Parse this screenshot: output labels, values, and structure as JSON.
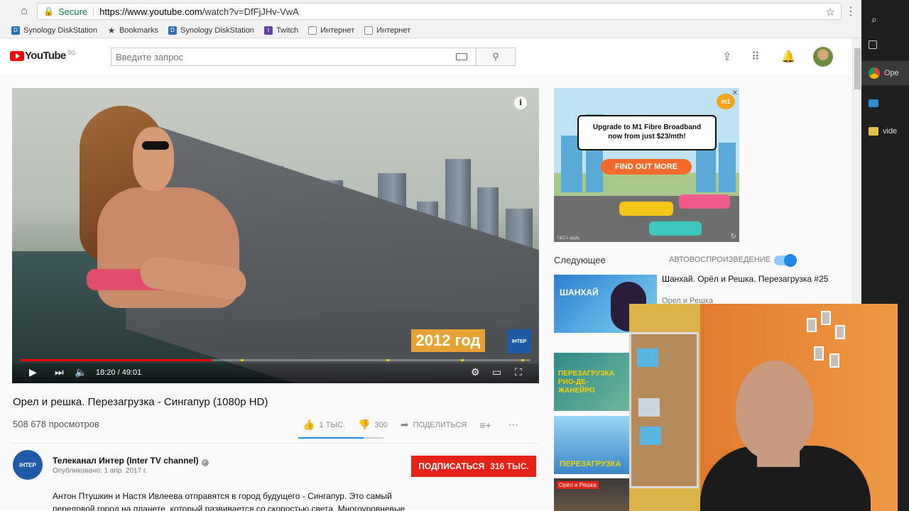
{
  "browser": {
    "secure_label": "Secure",
    "url_host": "https://www.youtube.com",
    "url_path": "/watch?v=DfFjJHv-VwA",
    "bookmarks": [
      {
        "label": "Synology DiskStation",
        "icon": "dsm"
      },
      {
        "label": "Bookmarks",
        "icon": "star"
      },
      {
        "label": "Synology DiskStation",
        "icon": "dsm"
      },
      {
        "label": "Twitch",
        "icon": "twitch"
      },
      {
        "label": "Интернет",
        "icon": "doc"
      },
      {
        "label": "Интернет",
        "icon": "doc"
      }
    ]
  },
  "desktop_strip": {
    "items": [
      {
        "label": "",
        "icon": "search-icon"
      },
      {
        "label": "",
        "icon": "task-view-icon"
      },
      {
        "label": "Ope",
        "icon": "chrome-icon"
      },
      {
        "label": "",
        "icon": "computer-icon"
      },
      {
        "label": "vide",
        "icon": "folder-icon"
      }
    ]
  },
  "youtube": {
    "logo_text": "YouTube",
    "region": "SG",
    "search_placeholder": "Введите запрос"
  },
  "player": {
    "time": "18:20 / 49:01",
    "progress_fraction": 0.374,
    "year_badge": "2012 год",
    "channel_watermark": "ІНТЕР"
  },
  "video": {
    "title": "Орел и решка. Перезагрузка - Сингапур (1080p HD)",
    "views": "508 678 просмотров",
    "likes": "1 ТЫС.",
    "dislikes": "300",
    "share": "ПОДЕЛИТЬСЯ",
    "like_ratio": 0.77
  },
  "channel": {
    "avatar_text": "ІНТЕР",
    "name": "Телеканал Интер (Inter TV channel)",
    "published": "Опубликовано: 1 апр. 2017 г.",
    "subscribe": "ПОДПИСАТЬСЯ",
    "subscribers": "316 ТЫС.",
    "description": "Антон Птушкин и Настя Ивлеева отправятся в город будущего - Сингапур. Это самый передовой город на планете, который развивается со скоростью света. Многоуровневые"
  },
  "ad": {
    "headline_line1": "Upgrade to M1 Fibre Broadband",
    "headline_line2": "now from just $23/mth!",
    "cta": "FIND OUT MORE",
    "brand": "m1",
    "terms": "T&C's apply"
  },
  "sidebar": {
    "next_label": "Следующее",
    "autoplay_label": "АВТОВОСПРОИЗВЕДЕНИЕ",
    "autoplay_on": true,
    "related": [
      {
        "title": "Шанхай. Орёл и Решка. Перезагрузка #25",
        "channel": "Орел и Решка",
        "thumb_text": "ШАНХАЙ"
      },
      {
        "title": "",
        "channel": "",
        "thumb_text": "ПЕРЕЗАГРУЗКА РИО-ДЕ-ЖАНЕЙРО"
      },
      {
        "title": "",
        "channel": "",
        "thumb_text": "ПЕРЕЗАГРУЗКА"
      },
      {
        "title": "",
        "channel": "",
        "thumb_text": "Орёл и Решка"
      }
    ]
  },
  "colors": {
    "youtube_red": "#ff0000",
    "subscribe_red": "#e62117",
    "autoplay_blue": "#1e88e5",
    "secure_green": "#0b8043"
  }
}
